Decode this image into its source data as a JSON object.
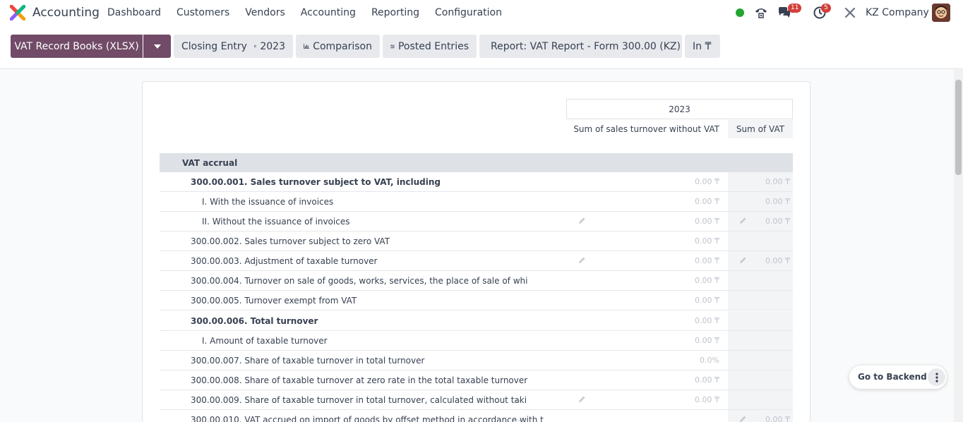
{
  "app": {
    "name": "Accounting",
    "logo_icon": "odoo-accounting-logo-icon"
  },
  "menu": [
    "Dashboard",
    "Customers",
    "Vendors",
    "Accounting",
    "Reporting",
    "Configuration"
  ],
  "systray": {
    "presence_color": "#21a52f",
    "messages_count": "11",
    "activities_count": "5",
    "company": "KZ Company"
  },
  "toolbar": {
    "primary_label": "VAT Record Books (XLSX)",
    "closing_entry": "Closing Entry",
    "period": "2023",
    "comparison": "Comparison",
    "posted_entries": "Posted Entries",
    "report": "Report: VAT Report - Form 300.00 (KZ)",
    "currency": "In ₸"
  },
  "table": {
    "period_header": "2023",
    "col1_header": "Sum of sales turnover without VAT",
    "col2_header": "Sum of VAT",
    "section": "VAT accrual",
    "rows": [
      {
        "label": "300.00.001. Sales turnover subject to VAT, including",
        "v1": "0.00 ₸",
        "v2": "0.00 ₸",
        "bold": true,
        "indent": 1
      },
      {
        "label": "I. With the issuance of invoices",
        "v1": "0.00 ₸",
        "v2": "0.00 ₸",
        "indent": 2
      },
      {
        "label": "II. Without the issuance of invoices",
        "v1": "0.00 ₸",
        "v2": "0.00 ₸",
        "indent": 2,
        "pen1": true,
        "pen2": true
      },
      {
        "label": "300.00.002. Sales turnover subject to zero VAT",
        "v1": "0.00 ₸",
        "v2": "",
        "indent": 1
      },
      {
        "label": "300.00.003. Adjustment of taxable turnover",
        "v1": "0.00 ₸",
        "v2": "0.00 ₸",
        "indent": 1,
        "pen1": true,
        "pen2": true
      },
      {
        "label": "300.00.004. Turnover on sale of goods, works, services, the place of sale of whi",
        "v1": "0.00 ₸",
        "v2": "",
        "indent": 1,
        "more": true
      },
      {
        "label": "300.00.005. Turnover exempt from VAT",
        "v1": "0.00 ₸",
        "v2": "",
        "indent": 1
      },
      {
        "label": "300.00.006. Total turnover",
        "v1": "0.00 ₸",
        "v2": "",
        "bold": true,
        "indent": 1
      },
      {
        "label": "I. Amount of taxable turnover",
        "v1": "0.00 ₸",
        "v2": "",
        "indent": 2
      },
      {
        "label": "300.00.007. Share of taxable turnover in total turnover",
        "v1": "0.0%",
        "v2": "",
        "indent": 1
      },
      {
        "label": "300.00.008. Share of taxable turnover at zero rate in the total taxable turnover",
        "v1": "0.00 ₸",
        "v2": "",
        "indent": 1
      },
      {
        "label": "300.00.009. Share of taxable turnover in total turnover, calculated without taki",
        "v1": "0.00 ₸",
        "v2": "",
        "indent": 1,
        "more": true,
        "pen1": true
      },
      {
        "label": "300.00.010. VAT accrued on import of goods by offset method in accordance with t",
        "v1": "",
        "v2": "0.00 ₸",
        "indent": 1,
        "more": true,
        "pen2": true
      }
    ]
  },
  "floating": {
    "go_backend": "Go to Backend"
  }
}
